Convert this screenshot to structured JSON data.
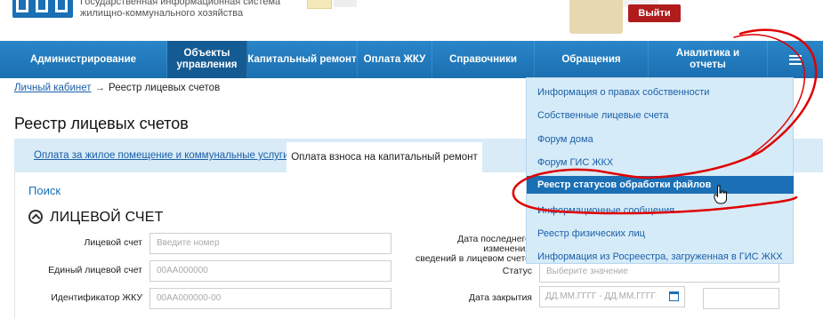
{
  "header": {
    "system_line1": "Государственная информационная система",
    "system_line2": "жилищно-коммунального хозяйства",
    "logout_label": "Выйти"
  },
  "nav": {
    "items": [
      {
        "label": "Администрирование"
      },
      {
        "label": "Объекты управления"
      },
      {
        "label": "Капитальный ремонт"
      },
      {
        "label": "Оплата ЖКУ"
      },
      {
        "label": "Справочники"
      },
      {
        "label": "Обращения"
      },
      {
        "label": "Аналитика и отчеты"
      }
    ],
    "menu_icon": "hamburger-icon"
  },
  "breadcrumb": {
    "link": "Личный кабинет",
    "separator": "→",
    "current": "Реестр лицевых счетов"
  },
  "page_title": "Реестр лицевых счетов",
  "tabs": [
    {
      "label": "Оплата за жилое помещение и коммунальные услуги"
    },
    {
      "label": "Оплата взноса на капитальный ремонт"
    }
  ],
  "search": {
    "title": "Поиск",
    "section_title": "ЛИЦЕВОЙ СЧЕТ",
    "fields": {
      "account_label": "Лицевой счет",
      "account_placeholder": "Введите номер",
      "unified_label": "Единый лицевой счет",
      "unified_placeholder": "00АА000000",
      "gku_label": "Идентификатор ЖКУ",
      "gku_placeholder": "00АА000000-00",
      "last_change_label_1": "Дата последнего изменения",
      "last_change_label_2": "сведений в лицевом счете",
      "status_label": "Статус",
      "status_placeholder": "Выберите значение",
      "close_date_label": "Дата закрытия",
      "date_from": "ДД.ММ.ГГГГ",
      "date_sep": "-",
      "date_to": "ДД.ММ.ГГГГ"
    }
  },
  "dropdown": {
    "items": [
      {
        "label": "Информация о правах собственности"
      },
      {
        "label": "Собственные лицевые счета"
      },
      {
        "label": "Форум дома"
      },
      {
        "label": "Форум ГИС ЖКХ"
      },
      {
        "label": "Реестр статусов обработки файлов"
      },
      {
        "label": "Информационные сообщения"
      },
      {
        "label": "Реестр физических лиц"
      },
      {
        "label": "Информация из Росреестра, загруженная в ГИС ЖКХ"
      }
    ],
    "active_index": 4
  },
  "colors": {
    "nav": "#1a6fb0",
    "accent": "#1a6fb5",
    "annotation": "#e00000",
    "logout": "#b01c1c"
  }
}
